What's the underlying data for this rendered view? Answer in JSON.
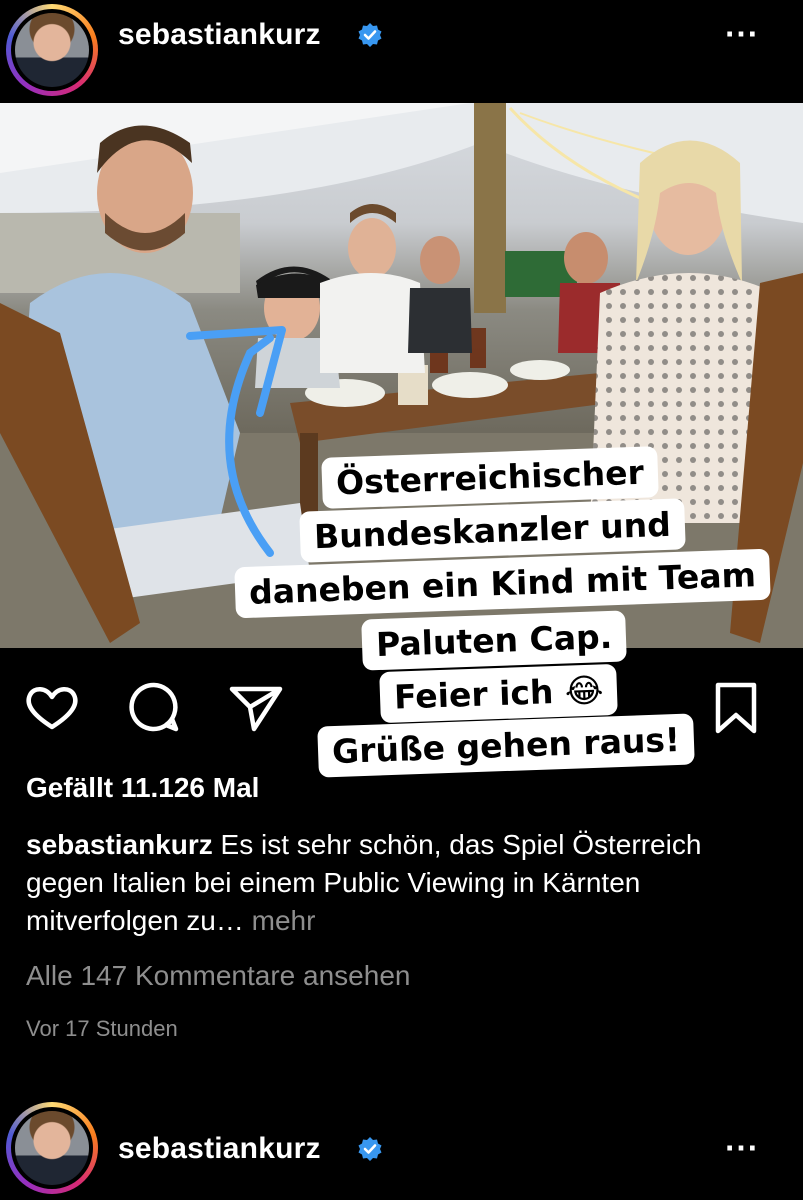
{
  "post": {
    "username": "sebastiankurz",
    "more_icon": "⋯",
    "likes_text": "Gefällt 11.126 Mal",
    "caption_user": "sebastiankurz",
    "caption_text": " Es ist sehr schön, das Spiel Österreich gegen Italien bei einem Public Viewing in Kärnten mitverfolgen zu…",
    "caption_more": " mehr",
    "comments_link": "Alle 147 Kommentare ansehen",
    "timestamp": "Vor 17 Stunden"
  },
  "sticker": {
    "lines": [
      "Österreichischer",
      "Bundeskanzler und",
      "daneben ein Kind mit Team",
      "Paluten Cap.",
      "Feier ich 😂",
      "Grüße gehen raus!"
    ]
  },
  "next_post": {
    "username": "sebastiankurz",
    "more_icon": "⋯"
  },
  "colors": {
    "verified_blue": "#3897f0",
    "arrow_blue": "#4a9ff5",
    "muted_text": "#8e8e8e"
  },
  "icons": [
    "heart-icon",
    "comment-icon",
    "share-icon",
    "bookmark-icon",
    "verified-icon",
    "user-tag-icon"
  ]
}
